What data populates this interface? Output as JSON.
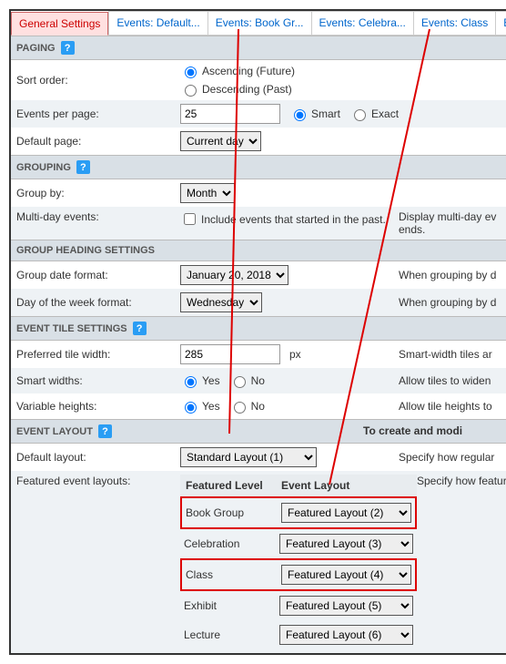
{
  "tabs": {
    "t0": "General Settings",
    "t1": "Events: Default...",
    "t2": "Events: Book Gr...",
    "t3": "Events: Celebra...",
    "t4": "Events: Class",
    "t5": "Events: E"
  },
  "sections": {
    "paging": "PAGING",
    "grouping": "GROUPING",
    "group_heading": "GROUP HEADING SETTINGS",
    "tile": "EVENT TILE SETTINGS",
    "layout": "EVENT LAYOUT",
    "layout_side": "To create and modi"
  },
  "paging": {
    "sort_label": "Sort order:",
    "sort_asc": "Ascending (Future)",
    "sort_desc": "Descending (Past)",
    "epp_label": "Events per page:",
    "epp_value": "25",
    "smart": "Smart",
    "exact": "Exact",
    "default_page_label": "Default page:",
    "default_page_value": "Current day"
  },
  "grouping": {
    "group_by_label": "Group by:",
    "group_by_value": "Month",
    "multi_label": "Multi-day events:",
    "multi_cb": "Include events that started in the past.",
    "multi_side": "Display multi-day ev",
    "multi_side2": "ends."
  },
  "group_heading": {
    "date_fmt_label": "Group date format:",
    "date_fmt_value": "January 20, 2018",
    "date_fmt_side": "When grouping by d",
    "dow_label": "Day of the week format:",
    "dow_value": "Wednesday",
    "dow_side": "When grouping by d"
  },
  "tile": {
    "pref_width_label": "Preferred tile width:",
    "pref_width_value": "285",
    "px": "px",
    "pref_width_side": "Smart-width tiles ar",
    "smart_widths_label": "Smart widths:",
    "yes": "Yes",
    "no": "No",
    "smart_widths_side": "Allow tiles to widen",
    "var_heights_label": "Variable heights:",
    "var_heights_side": "Allow tile heights to"
  },
  "layout": {
    "default_label": "Default layout:",
    "default_value": "Standard Layout (1)",
    "default_side": "Specify how regular",
    "featured_label": "Featured event layouts:",
    "featured_side": "Specify how feature",
    "head_level": "Featured Level",
    "head_layout": "Event Layout",
    "rows": {
      "r0": {
        "lvl": "Book Group",
        "lay": "Featured Layout (2)"
      },
      "r1": {
        "lvl": "Celebration",
        "lay": "Featured Layout (3)"
      },
      "r2": {
        "lvl": "Class",
        "lay": "Featured Layout (4)"
      },
      "r3": {
        "lvl": "Exhibit",
        "lay": "Featured Layout (5)"
      },
      "r4": {
        "lvl": "Lecture",
        "lay": "Featured Layout (6)"
      }
    }
  }
}
